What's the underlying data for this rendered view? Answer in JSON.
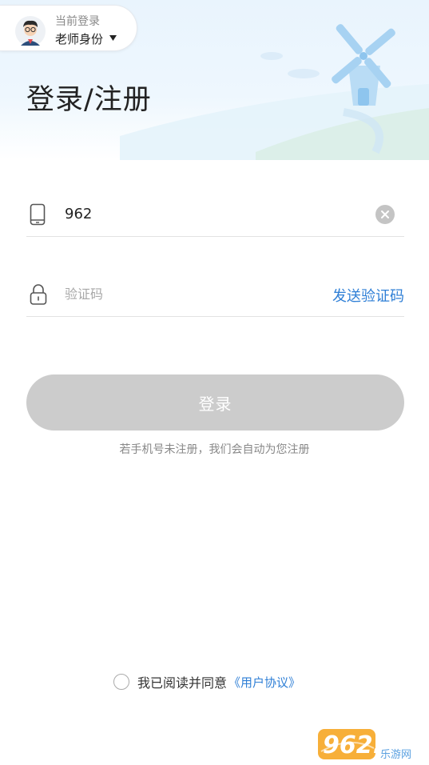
{
  "header": {
    "current_login_label": "当前登录",
    "role_label": "老师身份",
    "title": "登录/注册"
  },
  "form": {
    "phone_value": "962",
    "code_placeholder": "验证码",
    "send_code_label": "发送验证码",
    "login_label": "登录",
    "hint": "若手机号未注册，我们会自动为您注册"
  },
  "agreement": {
    "text": "我已阅读并同意",
    "link": "《用户协议》",
    "checked": false
  },
  "watermark": {
    "brand": "962.NET",
    "subtitle": "乐游网"
  },
  "colors": {
    "accent": "#2f7fd6",
    "button_disabled": "#cccccc",
    "hero_bg": "#e9f4fd"
  },
  "icons": {
    "phone": "phone-icon",
    "lock": "lock-icon",
    "clear": "clear-icon",
    "dropdown": "caret-down-icon"
  }
}
